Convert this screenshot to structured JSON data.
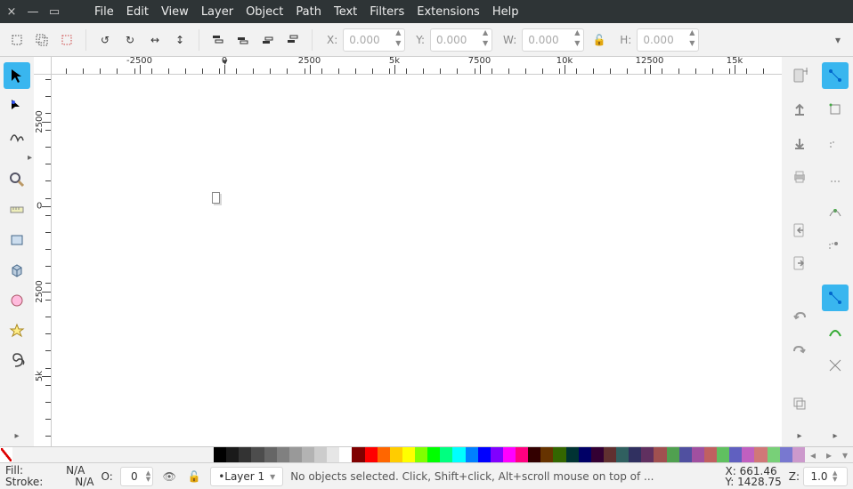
{
  "titlebar": {
    "close": "×",
    "min": "—",
    "max": "▭"
  },
  "menu": [
    "File",
    "Edit",
    "View",
    "Layer",
    "Object",
    "Path",
    "Text",
    "Filters",
    "Extensions",
    "Help"
  ],
  "options": {
    "x_label": "X:",
    "y_label": "Y:",
    "w_label": "W:",
    "h_label": "H:",
    "x": "0.000",
    "y": "0.000",
    "w": "0.000",
    "h": "0.000"
  },
  "ruler_labels_h": [
    "-2500",
    "0",
    "2500",
    "5k",
    "7500",
    "10k",
    "12500",
    "15k"
  ],
  "ruler_labels_v": [
    "2500",
    "0",
    "2500",
    "5k"
  ],
  "palette": [
    "#000000",
    "#1a1a1a",
    "#333333",
    "#4d4d4d",
    "#666666",
    "#808080",
    "#999999",
    "#b3b3b3",
    "#cccccc",
    "#e6e6e6",
    "#ffffff",
    "#800000",
    "#ff0000",
    "#ff6600",
    "#ffcc00",
    "#ffff00",
    "#80ff00",
    "#00ff00",
    "#00ff80",
    "#00ffff",
    "#0080ff",
    "#0000ff",
    "#8000ff",
    "#ff00ff",
    "#ff0080",
    "#330000",
    "#663300",
    "#336600",
    "#003333",
    "#000066",
    "#330033",
    "#603030",
    "#306060",
    "#303060",
    "#603060",
    "#a05050",
    "#50a050",
    "#5050a0",
    "#a050a0",
    "#c06060",
    "#60c060",
    "#6060c0",
    "#c060c0",
    "#d07878",
    "#78d078",
    "#7878d0",
    "#cc99cc"
  ],
  "status": {
    "fill_label": "Fill:",
    "fill_value": "N/A",
    "stroke_label": "Stroke:",
    "stroke_value": "N/A",
    "o_label": "O:",
    "o_value": "0",
    "layer": "•Layer 1",
    "message": "No objects selected. Click, Shift+click, Alt+scroll mouse on top of ...",
    "x_label": "X:",
    "x_val": "661.46",
    "y_label": "Y:",
    "y_val": "1428.75",
    "z_label": "Z:",
    "z_val": "1.0"
  }
}
